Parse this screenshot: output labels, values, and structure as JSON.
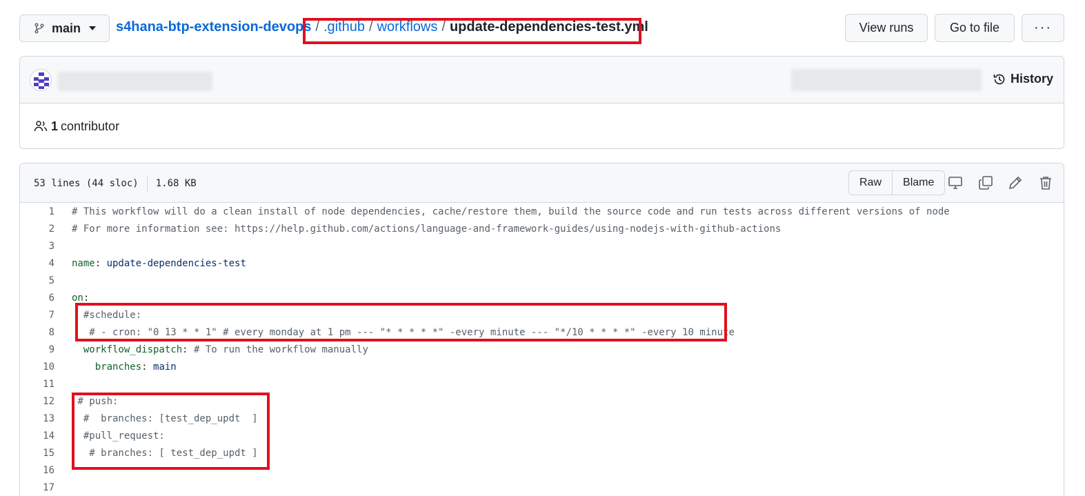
{
  "branch": {
    "name": "main"
  },
  "breadcrumb": {
    "repo": "s4hana-btp-extension-devops",
    "dir1": ".github",
    "dir2": "workflows",
    "file": "update-dependencies-test.yml",
    "sep": "/"
  },
  "actions": {
    "view_runs": "View runs",
    "go_to_file": "Go to file",
    "more": "···"
  },
  "commit": {
    "history_label": "History"
  },
  "contributors": {
    "count": "1",
    "label": "contributor"
  },
  "file": {
    "lines_info": "53 lines (44 sloc)",
    "size": "1.68 KB",
    "raw_label": "Raw",
    "blame_label": "Blame"
  },
  "code_lines": [
    {
      "n": "1",
      "parts": [
        {
          "t": "# This workflow will do a clean install of node dependencies, cache/restore them, build the source code and run tests across different versions of node",
          "c": "comment"
        }
      ]
    },
    {
      "n": "2",
      "parts": [
        {
          "t": "# For more information see: https://help.github.com/actions/language-and-framework-guides/using-nodejs-with-github-actions",
          "c": "comment"
        }
      ]
    },
    {
      "n": "3",
      "parts": []
    },
    {
      "n": "4",
      "parts": [
        {
          "t": "name",
          "c": "key"
        },
        {
          "t": ": ",
          "c": "plain"
        },
        {
          "t": "update-dependencies-test",
          "c": "val"
        }
      ]
    },
    {
      "n": "5",
      "parts": []
    },
    {
      "n": "6",
      "parts": [
        {
          "t": "on",
          "c": "key"
        },
        {
          "t": ":",
          "c": "plain"
        }
      ]
    },
    {
      "n": "7",
      "parts": [
        {
          "t": "  #schedule:",
          "c": "comment"
        }
      ]
    },
    {
      "n": "8",
      "parts": [
        {
          "t": "   # - cron: \"0 13 * * 1\" # every monday at 1 pm --- \"* * * * *\" -every minute --- \"*/10 * * * *\" -every 10 minute",
          "c": "comment"
        }
      ]
    },
    {
      "n": "9",
      "parts": [
        {
          "t": "  ",
          "c": "plain"
        },
        {
          "t": "workflow_dispatch",
          "c": "key"
        },
        {
          "t": ": ",
          "c": "plain"
        },
        {
          "t": "# To run the workflow manually",
          "c": "comment"
        }
      ]
    },
    {
      "n": "10",
      "parts": [
        {
          "t": "    ",
          "c": "plain"
        },
        {
          "t": "branches",
          "c": "key"
        },
        {
          "t": ": ",
          "c": "plain"
        },
        {
          "t": "main",
          "c": "val"
        }
      ]
    },
    {
      "n": "11",
      "parts": []
    },
    {
      "n": "12",
      "parts": [
        {
          "t": " # push:",
          "c": "comment"
        }
      ]
    },
    {
      "n": "13",
      "parts": [
        {
          "t": "  #  branches: [test_dep_updt  ]",
          "c": "comment"
        }
      ]
    },
    {
      "n": "14",
      "parts": [
        {
          "t": "  #pull_request:",
          "c": "comment"
        }
      ]
    },
    {
      "n": "15",
      "parts": [
        {
          "t": "   # branches: [ test_dep_updt ]",
          "c": "comment"
        }
      ]
    },
    {
      "n": "16",
      "parts": []
    },
    {
      "n": "17",
      "parts": []
    }
  ],
  "colors": {
    "highlight": "#e0101e",
    "link": "#0969da",
    "border": "#d0d7de"
  }
}
